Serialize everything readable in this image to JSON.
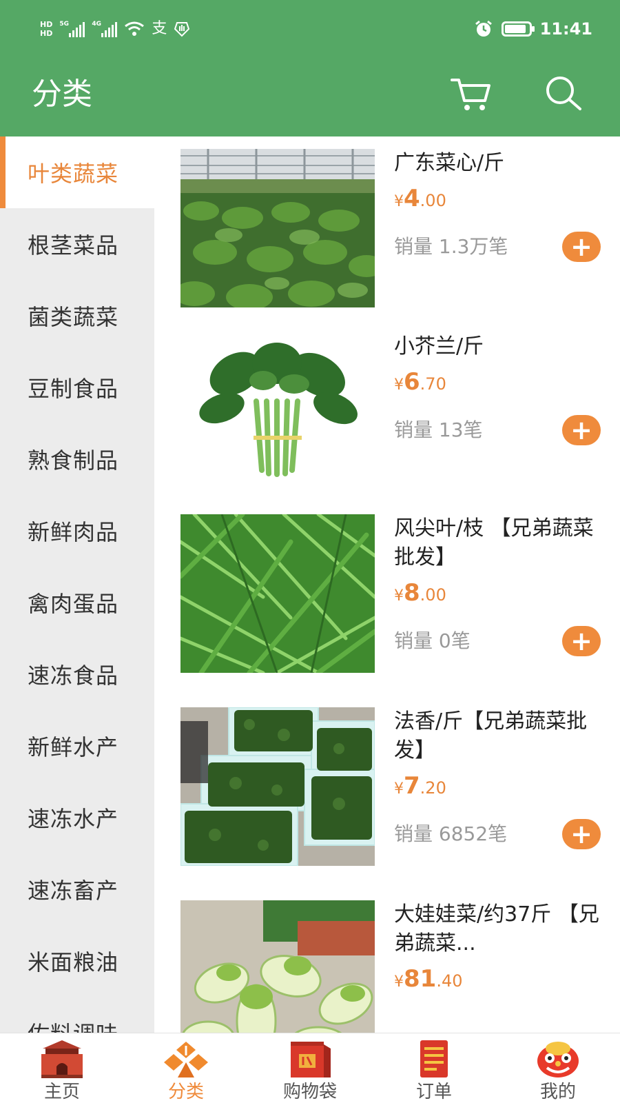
{
  "status_bar": {
    "hd1": "HD",
    "hd2": "HD",
    "net1": "5G",
    "net2": "4G",
    "pay_glyph": "支",
    "time": "11:41",
    "icons": [
      "signal-icon",
      "wifi-icon",
      "alipay-icon",
      "hand-icon",
      "alarm-icon",
      "battery-icon"
    ]
  },
  "header": {
    "title": "分类",
    "icons": [
      "cart-icon",
      "search-icon"
    ]
  },
  "colors": {
    "brand_green": "#55a865",
    "accent_orange": "#ef8b3c",
    "sidebar_bg": "#ececec"
  },
  "sidebar": {
    "items": [
      {
        "label": "叶类蔬菜",
        "active": true
      },
      {
        "label": "根茎菜品"
      },
      {
        "label": "菌类蔬菜"
      },
      {
        "label": "豆制食品"
      },
      {
        "label": "熟食制品"
      },
      {
        "label": "新鲜肉品"
      },
      {
        "label": "禽肉蛋品"
      },
      {
        "label": "速冻食品"
      },
      {
        "label": "新鲜水产"
      },
      {
        "label": "速冻水产"
      },
      {
        "label": "速冻畜产"
      },
      {
        "label": "米面粮油"
      },
      {
        "label": "佐料调味"
      }
    ]
  },
  "products": [
    {
      "name": "广东菜心/斤",
      "currency": "¥",
      "price_int": "4",
      "price_dec": ".00",
      "sales": "销量 1.3万笔",
      "add": "+"
    },
    {
      "name": "小芥兰/斤",
      "currency": "¥",
      "price_int": "6",
      "price_dec": ".70",
      "sales": "销量 13笔",
      "add": "+"
    },
    {
      "name": "风尖叶/枝 【兄弟蔬菜批发】",
      "currency": "¥",
      "price_int": "8",
      "price_dec": ".00",
      "sales": "销量 0笔",
      "add": "+"
    },
    {
      "name": "法香/斤【兄弟蔬菜批发】",
      "currency": "¥",
      "price_int": "7",
      "price_dec": ".20",
      "sales": "销量 6852笔",
      "add": "+"
    },
    {
      "name": "大娃娃菜/约37斤 【兄弟蔬菜...",
      "currency": "¥",
      "price_int": "81",
      "price_dec": ".40",
      "sales": "",
      "add": "+"
    }
  ],
  "bottom_nav": {
    "items": [
      {
        "label": "主页",
        "icon": "home-gate-icon"
      },
      {
        "label": "分类",
        "icon": "category-icon",
        "active": true
      },
      {
        "label": "购物袋",
        "icon": "shopping-bag-icon"
      },
      {
        "label": "订单",
        "icon": "order-list-icon"
      },
      {
        "label": "我的",
        "icon": "lion-avatar-icon"
      }
    ]
  }
}
